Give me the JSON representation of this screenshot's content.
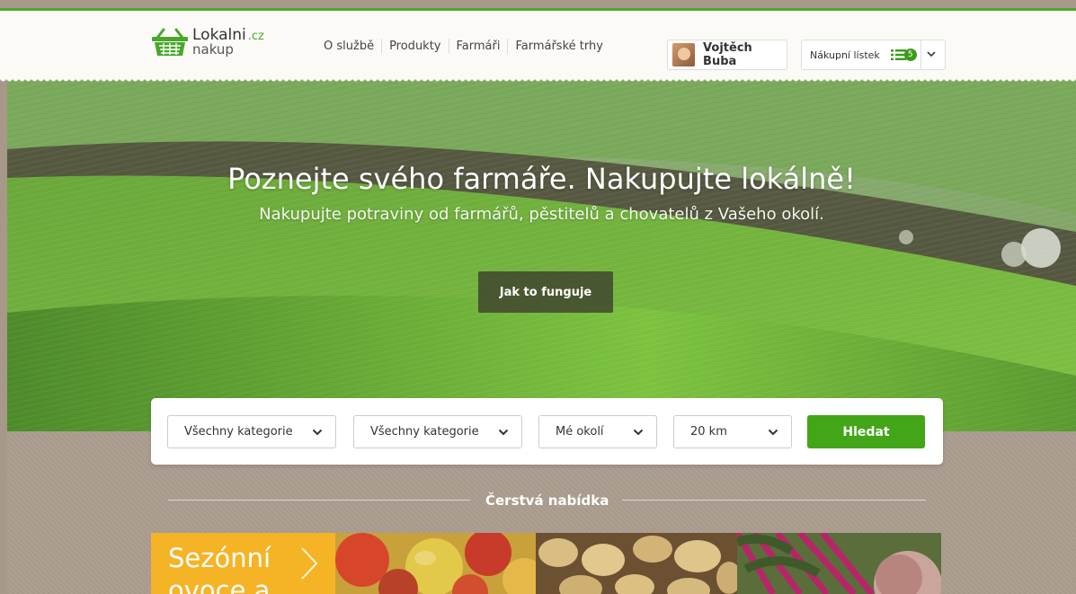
{
  "header": {
    "logo": {
      "name": "Lokalni",
      "tld": ".cz",
      "sub": "nakup"
    },
    "nav": [
      "O službě",
      "Produkty",
      "Farmáři",
      "Farmářské trhy"
    ],
    "user": {
      "name": "Vojtěch Buba"
    },
    "shopping_list": {
      "label": "Nákupní lístek",
      "count": "5"
    }
  },
  "hero": {
    "title": "Poznejte svého farmáře. Nakupujte lokálně!",
    "subtitle": "Nakupujte potraviny od farmářů, pěstitelů a chovatelů z Vašeho okolí.",
    "button": "Jak to funguje"
  },
  "search": {
    "category1": "Všechny kategorie",
    "category2": "Všechny kategorie",
    "location": "Mé okolí",
    "distance": "20 km",
    "button": "Hledat"
  },
  "fresh": {
    "title": "Čerstvá nabídka",
    "tile_label": "Sezónní ovoce a"
  },
  "colors": {
    "brand_green": "#42a618",
    "accent_orange": "#f5b326"
  }
}
